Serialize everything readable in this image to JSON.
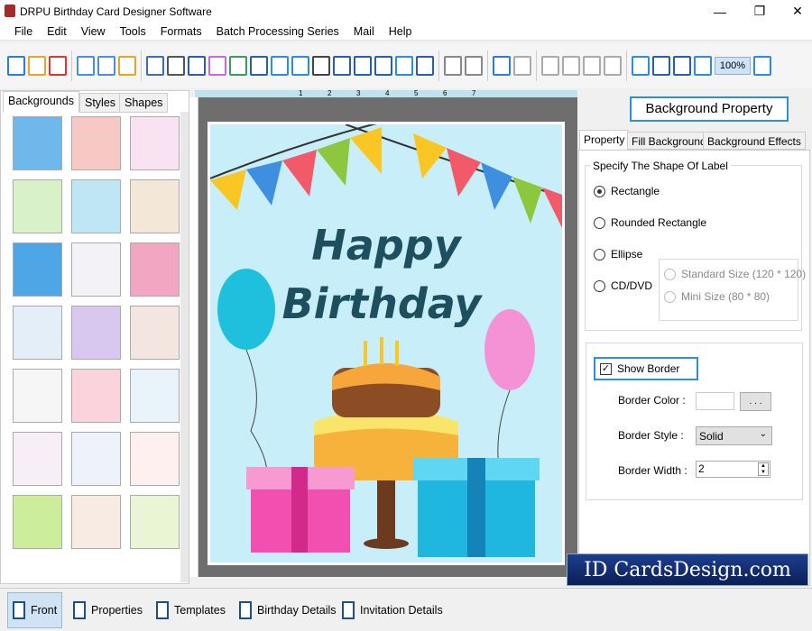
{
  "window": {
    "title": "DRPU Birthday Card Designer Software",
    "minimize": "—",
    "maximize": "❐",
    "close": "✕"
  },
  "menu": [
    "File",
    "Edit",
    "View",
    "Tools",
    "Formats",
    "Batch Processing Series",
    "Mail",
    "Help"
  ],
  "toolbar": {
    "zoom": "100%",
    "icons": [
      "new-icon",
      "open-icon",
      "close-icon",
      "save-icon",
      "save-as-icon",
      "export-icon",
      "properties-icon",
      "print-icon",
      "print-preview-icon",
      "gift-icon",
      "image-icon",
      "pen-icon",
      "shape-icon",
      "watermark-icon",
      "barcode-icon",
      "text-icon",
      "word-art-icon",
      "signature-icon",
      "mail-icon",
      "line-icon",
      "database-icon",
      "database2-icon",
      "undo-icon",
      "redo-icon",
      "cut-icon",
      "copy-icon",
      "paste-icon",
      "delete-icon",
      "grid-icon",
      "actual-size-icon",
      "fit-icon",
      "zoom-in-icon",
      "zoom-out-icon"
    ]
  },
  "left_panel": {
    "tabs": [
      "Backgrounds",
      "Styles",
      "Shapes"
    ],
    "active_tab": "Backgrounds",
    "thumbnails": [
      "#6fb8ec",
      "#f7c9c4",
      "#f9e3f2",
      "#d9f1c8",
      "#bfe6f5",
      "#f3e8d8",
      "#4fa6e6",
      "#f2f2f7",
      "#f3a6c2",
      "#e3eef8",
      "#d8c8f0",
      "#f3e6e0",
      "#f6f6f6",
      "#fbd3dc",
      "#e8f4fa",
      "#f8eef8",
      "#eef3fb",
      "#fff0f0",
      "#cbed9c",
      "#f8ebe4",
      "#eaf5d6"
    ]
  },
  "ruler": {
    "marks": [
      "1",
      "2",
      "3",
      "4",
      "5",
      "6",
      "7"
    ]
  },
  "card": {
    "line1": "Happy",
    "line2": "Birthday",
    "colors": {
      "background": "#c8eefa",
      "title": "#1d4f5f"
    }
  },
  "right_panel": {
    "header": "Background Property",
    "tabs": [
      "Property",
      "Fill Background",
      "Background Effects"
    ],
    "active_tab": "Property",
    "shape_group": {
      "title": "Specify The Shape Of Label",
      "options": [
        "Rectangle",
        "Rounded Rectangle",
        "Ellipse",
        "CD/DVD"
      ],
      "selected": "Rectangle",
      "cd_options": [
        "Standard Size (120 * 120)",
        "Mini Size (80 * 80)"
      ]
    },
    "border": {
      "show_border_label": "Show Border",
      "show_border": true,
      "color_label": "Border Color :",
      "color_button": ". . .",
      "style_label": "Border Style :",
      "style_value": "Solid",
      "width_label": "Border Width :",
      "width_value": "2"
    }
  },
  "bottom_bar": [
    "Front",
    "Properties",
    "Templates",
    "Birthday Details",
    "Invitation Details"
  ],
  "watermark": "ID CardsDesign.com",
  "accent": "#2d8fd6"
}
